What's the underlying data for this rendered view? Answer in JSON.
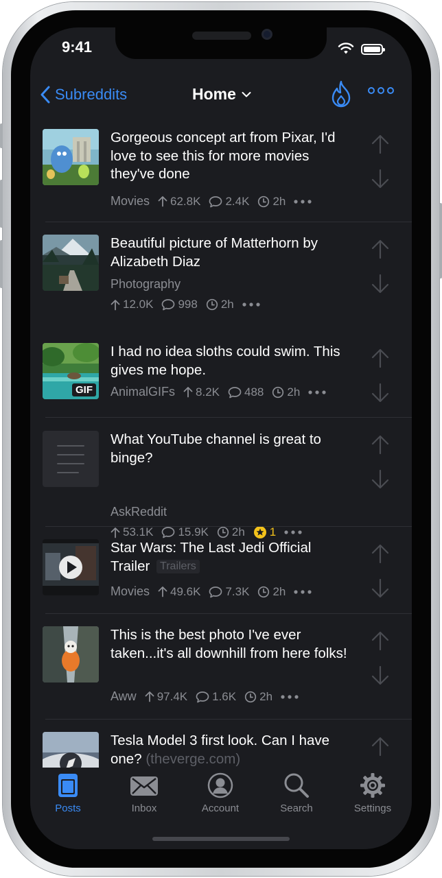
{
  "status_bar": {
    "time": "9:41"
  },
  "nav": {
    "back_label": "Subreddits",
    "title": "Home",
    "accent_color": "#3a8bf5"
  },
  "posts": [
    {
      "title": "Gorgeous concept art from Pixar, I'd love to see this for more movies they've done",
      "subreddit": "Movies",
      "upvotes": "62.8K",
      "comments": "2.4K",
      "age": "2h"
    },
    {
      "title": "Beautiful picture of Matterhorn by Alizabeth Diaz",
      "subreddit": "Photography",
      "upvotes": "12.0K",
      "comments": "998",
      "age": "2h"
    },
    {
      "title": "I had no idea sloths could swim. This gives me hope.",
      "subreddit": "AnimalGIFs",
      "upvotes": "8.2K",
      "comments": "488",
      "age": "2h",
      "badge": "GIF"
    },
    {
      "title": "What YouTube channel is great to binge?",
      "subreddit": "AskReddit",
      "upvotes": "53.1K",
      "comments": "15.9K",
      "age": "2h",
      "awards": "1"
    },
    {
      "title": "Star Wars: The Last Jedi Official Trailer",
      "flair": "Trailers",
      "subreddit": "Movies",
      "upvotes": "49.6K",
      "comments": "7.3K",
      "age": "2h"
    },
    {
      "title": "This is the best photo I've ever taken...it's all downhill from here folks!",
      "subreddit": "Aww",
      "upvotes": "97.4K",
      "comments": "1.6K",
      "age": "2h"
    },
    {
      "title": "Tesla Model 3 first look. Can I have one?",
      "domain": "(theverge.com)"
    }
  ],
  "tabs": [
    {
      "label": "Posts",
      "icon": "posts-icon",
      "active": true
    },
    {
      "label": "Inbox",
      "icon": "inbox-icon"
    },
    {
      "label": "Account",
      "icon": "account-icon"
    },
    {
      "label": "Search",
      "icon": "search-icon"
    },
    {
      "label": "Settings",
      "icon": "settings-icon"
    }
  ]
}
